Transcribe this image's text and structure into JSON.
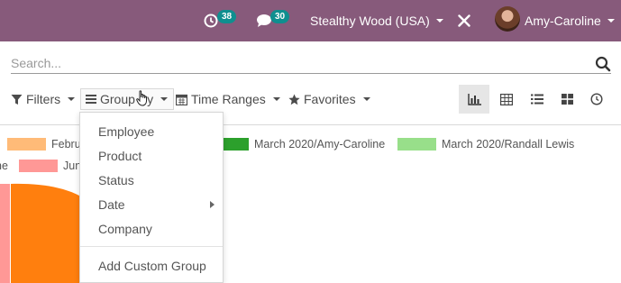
{
  "navbar": {
    "activities_badge": "38",
    "messages_badge": "30",
    "company": "Stealthy Wood (USA)",
    "user": "Amy-Caroline"
  },
  "search": {
    "placeholder": "Search..."
  },
  "toolbar": {
    "filters_label": "Filters",
    "groupby_label": "Group By",
    "timeranges_label": "Time Ranges",
    "favorites_label": "Favorites",
    "views": [
      "graph",
      "pivot",
      "list",
      "kanban",
      "activity"
    ],
    "active_view": "graph"
  },
  "legend": [
    {
      "label": "February",
      "color": "#ffbb78"
    },
    {
      "label": "March 2020/Amy-Caroline",
      "color": "#2ca02c"
    },
    {
      "label": "March 2020/Randall Lewis",
      "color": "#98df8a"
    },
    {
      "label": "June",
      "color": "#ff9896"
    }
  ],
  "groupby_menu": {
    "items": [
      "Employee",
      "Product",
      "Status",
      "Date",
      "Company"
    ],
    "custom": "Add Custom Group"
  },
  "colors": {
    "brand": "#875a7b",
    "badge": "#0f8f8f",
    "chart_orange": "#ff7f0e",
    "chart_pink": "#ff9896"
  }
}
